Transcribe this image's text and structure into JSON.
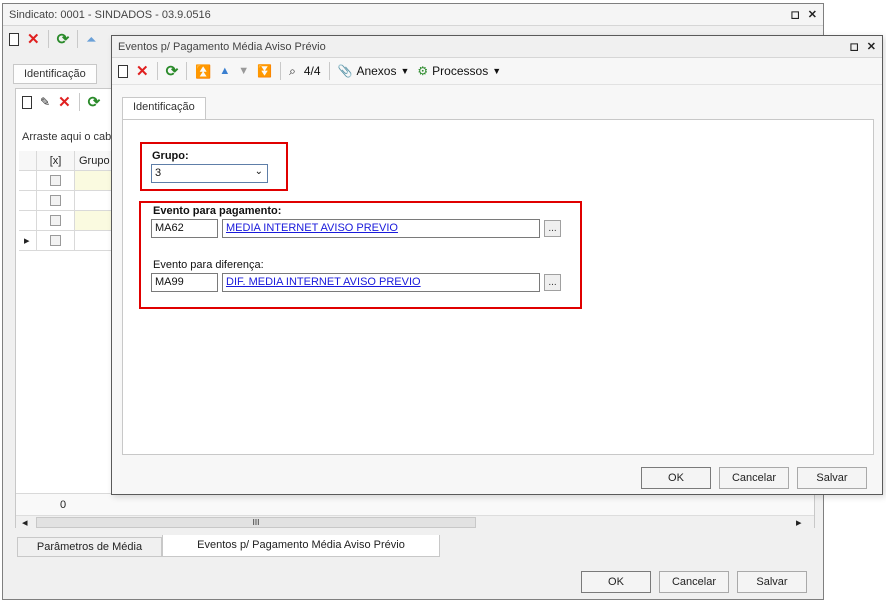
{
  "bg_window": {
    "title": "Sindicato: 0001 - SINDADOS - 03.9.0516",
    "restore_glyph": "◻",
    "close_glyph": "✕",
    "tab_identificacao": "Identificação",
    "grid_header_text": "Arraste aqui o cabe",
    "grid_col_check": "[x]",
    "grid_col_grupo": "Grupo",
    "row_indicator": "▸",
    "footer_count": "0",
    "scroll_thumb": "III",
    "scroll_left": "◂",
    "scroll_right": "▸",
    "bottom_tabs": [
      "Parâmetros de Média",
      "Eventos p/ Pagamento Média Aviso Prévio"
    ],
    "ok_label": "OK",
    "cancel_label": "Cancelar",
    "save_label": "Salvar"
  },
  "dialog": {
    "title": "Eventos p/ Pagamento Média Aviso Prévio",
    "restore_glyph": "◻",
    "close_glyph": "✕",
    "record_counter": "4/4",
    "menu_anexos": "Anexos",
    "menu_processos": "Processos",
    "tab_identificacao": "Identificação",
    "grupo": {
      "label": "Grupo:",
      "value": "3"
    },
    "evento_pagamento": {
      "label": "Evento para pagamento:",
      "code": "MA62",
      "description": "MEDIA INTERNET AVISO PREVIO",
      "lookup_label": "..."
    },
    "evento_diferenca": {
      "label": "Evento para diferença:",
      "code": "MA99",
      "description": "DIF. MEDIA INTERNET AVISO PREVIO",
      "lookup_label": "..."
    },
    "ok_label": "OK",
    "cancel_label": "Cancelar",
    "save_label": "Salvar"
  },
  "colors": {
    "highlight_border": "#e00000",
    "link_text": "#1a1adb"
  }
}
